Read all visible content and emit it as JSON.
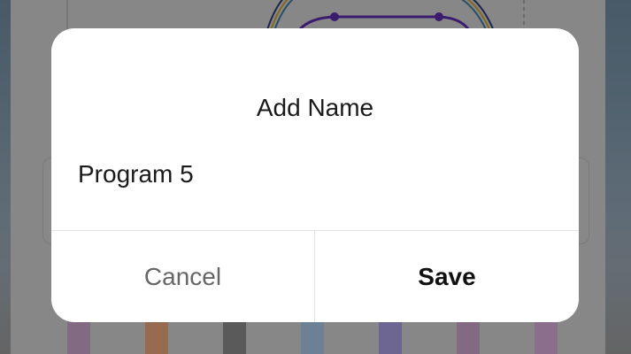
{
  "dialog": {
    "title": "Add Name",
    "name_value": "Program 5",
    "cancel_label": "Cancel",
    "save_label": "Save"
  },
  "colors": {
    "scrim": "#000000",
    "dialog_background": "#ffffff",
    "title_text": "#1a1a1a",
    "cancel_text": "#666666",
    "save_text": "#111111",
    "divider": "#e3e3e3",
    "background_curve": "#5b2aa8"
  }
}
